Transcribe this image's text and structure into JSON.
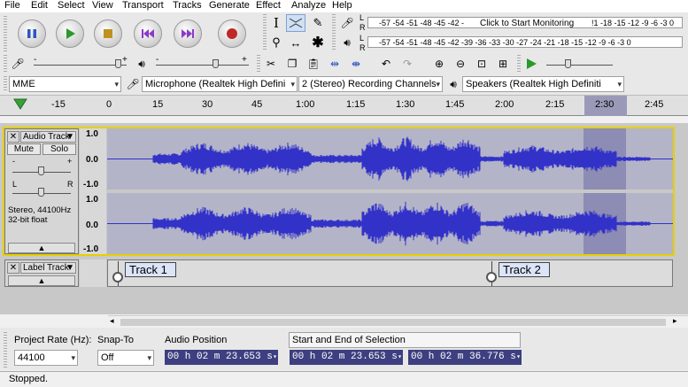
{
  "menu": [
    "File",
    "Edit",
    "Select",
    "View",
    "Transport",
    "Tracks",
    "Generate",
    "Effect",
    "Analyze",
    "Help"
  ],
  "meter": {
    "rec_scale": "-57 -54 -51 -48 -45 -42 -",
    "rec_prompt": "Click to Start Monitoring",
    "rec_scale_tail": "!1 -18 -15 -12 -9 -6 -3 0",
    "play_scale": "-57 -54 -51 -48 -45 -42 -39 -36 -33 -30 -27 -24 -21 -18 -15 -12 -9 -6 -3 0",
    "l": "L",
    "r": "R"
  },
  "device": {
    "host": "MME",
    "input": "Microphone (Realtek High Defini",
    "channels": "2 (Stereo) Recording Channels",
    "output": "Speakers (Realtek High Definiti"
  },
  "ruler": {
    "ticks": [
      "-15",
      "0",
      "15",
      "30",
      "45",
      "1:00",
      "1:15",
      "1:30",
      "1:45",
      "2:00",
      "2:15",
      "2:30",
      "2:45"
    ]
  },
  "audio_track": {
    "name": "Audio Track",
    "mute": "Mute",
    "solo": "Solo",
    "gain_minus": "-",
    "gain_plus": "+",
    "pan_l": "L",
    "pan_r": "R",
    "info_line1": "Stereo, 44100Hz",
    "info_line2": "32-bit float",
    "yticks": [
      "1.0",
      "0.0",
      "-1.0"
    ]
  },
  "label_track": {
    "name": "Label Track",
    "labels": [
      "Track 1",
      "Track 2"
    ]
  },
  "selection": {
    "rate_label": "Project Rate (Hz):",
    "rate_value": "44100",
    "snap_label": "Snap-To",
    "snap_value": "Off",
    "pos_label": "Audio Position",
    "pos_value": "00 h 02 m 23.653 s",
    "sel_label": "Start and End of Selection",
    "start_value": "00 h 02 m 23.653 s",
    "end_value": "00 h 02 m 36.776 s"
  },
  "status": "Stopped.",
  "colors": {
    "wave": "#3232c8",
    "wave_bg": "#b4b4c8",
    "selection": "#8c8cb4",
    "timecode": "#3d3f80"
  }
}
